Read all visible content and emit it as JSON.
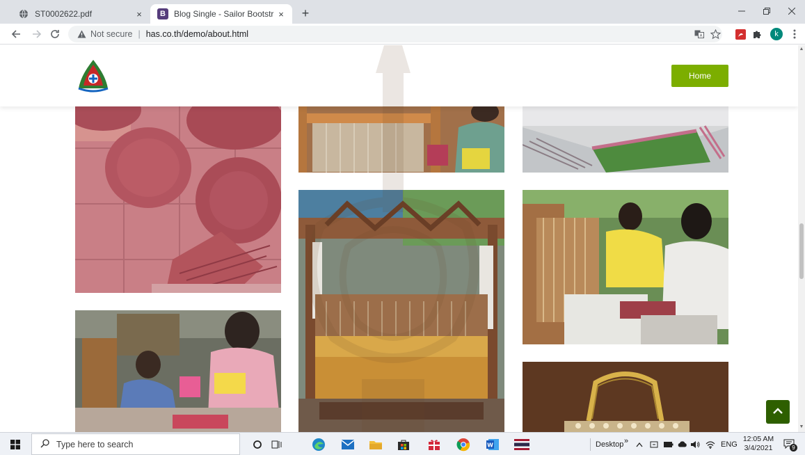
{
  "browser": {
    "tabs": [
      {
        "title": "ST0002622.pdf",
        "favicon": "globe-icon",
        "active": false
      },
      {
        "title": "Blog Single - Sailor Bootstrap Te",
        "favicon": "bootstrap-b-icon",
        "favicon_text": "B",
        "active": true
      }
    ],
    "new_tab_label": "+",
    "close_label": "×",
    "address": {
      "security_label": "Not secure",
      "separator": "|",
      "url": "has.co.th/demo/about.html"
    },
    "profile_initial": "k"
  },
  "site": {
    "brand": {
      "line1": "",
      "line2": "",
      "line3": ""
    },
    "nav": [
      {
        "label": "",
        "active": false
      },
      {
        "label": "",
        "active": true
      },
      {
        "label": "",
        "active": false
      },
      {
        "label": "",
        "active": false
      },
      {
        "label": "",
        "active": false
      },
      {
        "label": "",
        "active": false
      }
    ],
    "home_button": "Home",
    "colors": {
      "accent_green": "#7cae00",
      "active_nav": "#b71c1c",
      "brand_green": "#2e7d32",
      "back_to_top": "#2e5f00"
    }
  },
  "taskbar": {
    "search_placeholder": "Type here to search",
    "desktop_label": "Desktop",
    "overflow_label": "»",
    "language": "ENG",
    "time": "12:05 AM",
    "date": "3/4/2021",
    "notification_count": "9"
  }
}
